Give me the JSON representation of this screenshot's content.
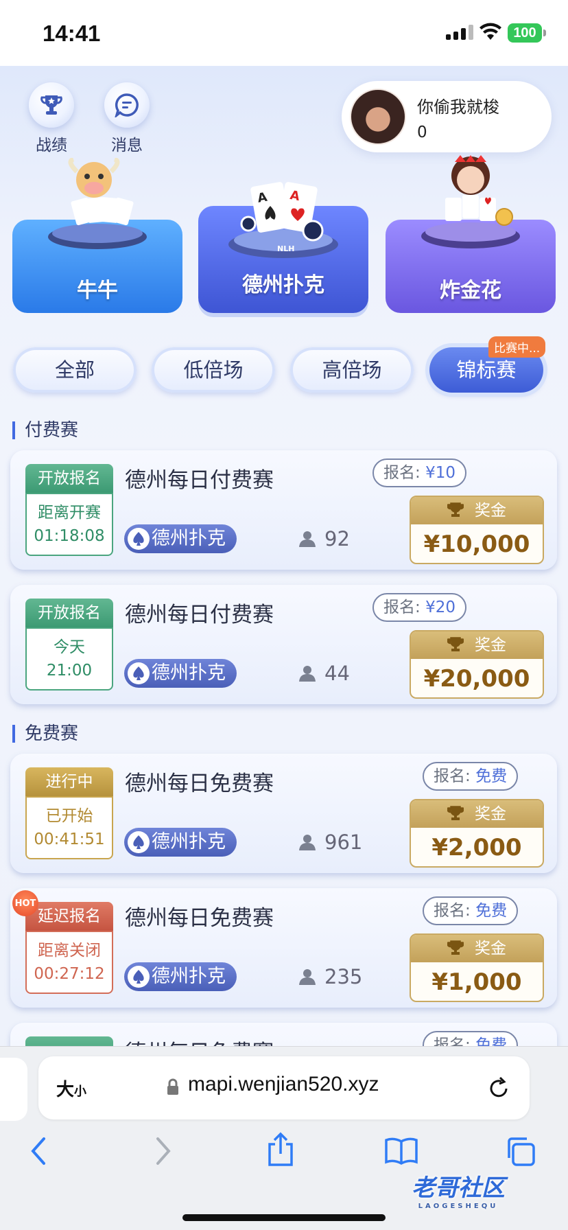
{
  "status_bar": {
    "time": "14:41",
    "battery": "100"
  },
  "top_nav": {
    "record_label": "战绩",
    "messages_label": "消息"
  },
  "profile": {
    "name": "你偷我就梭",
    "score": "0"
  },
  "games": [
    {
      "label": "牛牛"
    },
    {
      "label": "德州扑克",
      "table_text": "NLH"
    },
    {
      "label": "炸金花"
    }
  ],
  "filters": {
    "all": "全部",
    "low": "低倍场",
    "high": "高倍场",
    "tournament": "锦标赛",
    "tournament_badge": "比赛中..."
  },
  "sections": {
    "paid": "付费赛",
    "free": "免费赛"
  },
  "tournaments": [
    {
      "status": "开放报名",
      "status_color": "green",
      "timer_label": "距离开赛",
      "timer_value": "01:18:08",
      "title": "德州每日付费赛",
      "game": "德州扑克",
      "players": "92",
      "fee_label": "报名:",
      "fee": "¥10",
      "prize_label": "奖金",
      "prize": "¥10,000"
    },
    {
      "status": "开放报名",
      "status_color": "green",
      "timer_label": "今天",
      "timer_value": "21:00",
      "title": "德州每日付费赛",
      "game": "德州扑克",
      "players": "44",
      "fee_label": "报名:",
      "fee": "¥20",
      "prize_label": "奖金",
      "prize": "¥20,000"
    },
    {
      "status": "进行中",
      "status_color": "gold",
      "timer_label": "已开始",
      "timer_value": "00:41:51",
      "title": "德州每日免费赛",
      "game": "德州扑克",
      "players": "961",
      "fee_label": "报名:",
      "fee": "免费",
      "prize_label": "奖金",
      "prize": "¥2,000"
    },
    {
      "status": "延迟报名",
      "status_color": "red",
      "hot": "HOT",
      "timer_label": "距离关闭",
      "timer_value": "00:27:12",
      "title": "德州每日免费赛",
      "game": "德州扑克",
      "players": "235",
      "fee_label": "报名:",
      "fee": "免费",
      "prize_label": "奖金",
      "prize": "¥1,000"
    },
    {
      "title": "德州每日免费赛",
      "fee_label": "报名:",
      "fee": "免费"
    }
  ],
  "browser": {
    "text_size": "大",
    "text_size_small": "小",
    "url": "mapi.wenjian520.xyz"
  },
  "watermark": {
    "text": "老哥社区",
    "sub": "LAOGESHEQU"
  },
  "colors": {
    "accent": "#4169e1",
    "green": "#3c9a73",
    "gold": "#b6923d",
    "red": "#c55441"
  }
}
